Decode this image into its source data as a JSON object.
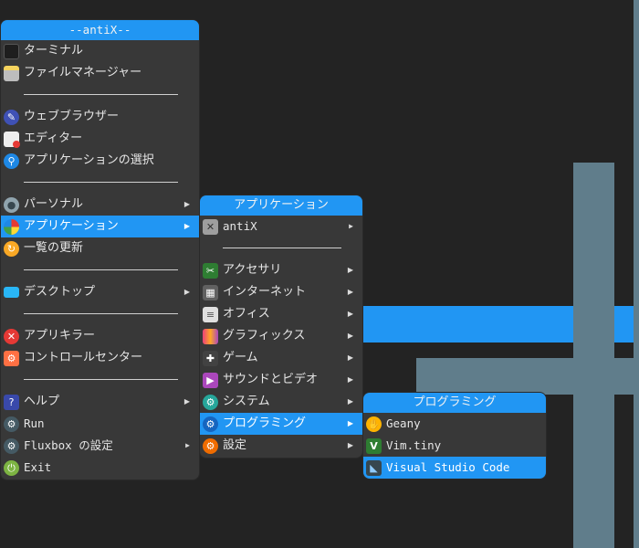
{
  "main_menu": {
    "title": "--antiX--",
    "items": {
      "terminal": "ターミナル",
      "file_manager": "ファイルマネージャー",
      "web_browser": "ウェブブラウザー",
      "editor": "エディター",
      "app_select": "アプリケーションの選択",
      "personal": "パーソナル",
      "applications": "アプリケーション",
      "refresh_list": "一覧の更新",
      "desktop": "デスクトップ",
      "app_killer": "アプリキラー",
      "control_center": "コントロールセンター",
      "help": "ヘルプ",
      "run": "Run",
      "fluxbox_settings": "Fluxbox の設定",
      "exit": "Exit"
    }
  },
  "applications_menu": {
    "title": "アプリケーション",
    "items": {
      "antix": "antiX",
      "accessories": "アクセサリ",
      "internet": "インターネット",
      "office": "オフィス",
      "graphics": "グラフィックス",
      "games": "ゲーム",
      "sound_video": "サウンドとビデオ",
      "system": "システム",
      "programming": "プログラミング",
      "settings": "設定"
    }
  },
  "programming_menu": {
    "title": "プログラミング",
    "items": {
      "geany": "Geany",
      "vim_tiny": "Vim.tiny",
      "vscode": "Visual Studio Code"
    }
  },
  "colors": {
    "accent": "#2196f3",
    "menu_bg": "#383838",
    "desktop_bg": "#232323",
    "wallpaper_slate": "#607d8b"
  }
}
